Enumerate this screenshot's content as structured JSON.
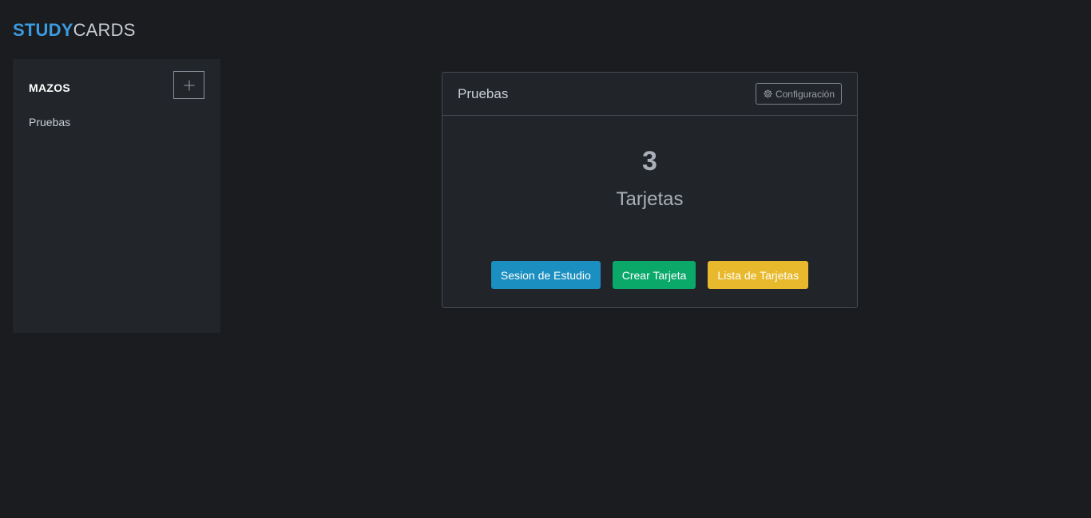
{
  "logo": {
    "part1": "STUDY",
    "part2": "CARDS"
  },
  "sidebar": {
    "title": "MAZOS",
    "add_icon": "plus-icon",
    "decks": [
      {
        "label": "Pruebas"
      }
    ]
  },
  "deck_card": {
    "name": "Pruebas",
    "config_label": "Configuración",
    "config_icon": "gear-icon",
    "card_count": "3",
    "card_count_label": "Tarjetas",
    "actions": {
      "study": "Sesion de Estudio",
      "create": "Crear Tarjeta",
      "list": "Lista de Tarjetas"
    }
  },
  "colors": {
    "brand_accent": "#3b9be0",
    "study_button": "#1b8fc0",
    "create_button": "#0aa96a",
    "list_button": "#e8b92c",
    "background": "#1a1c1f"
  }
}
